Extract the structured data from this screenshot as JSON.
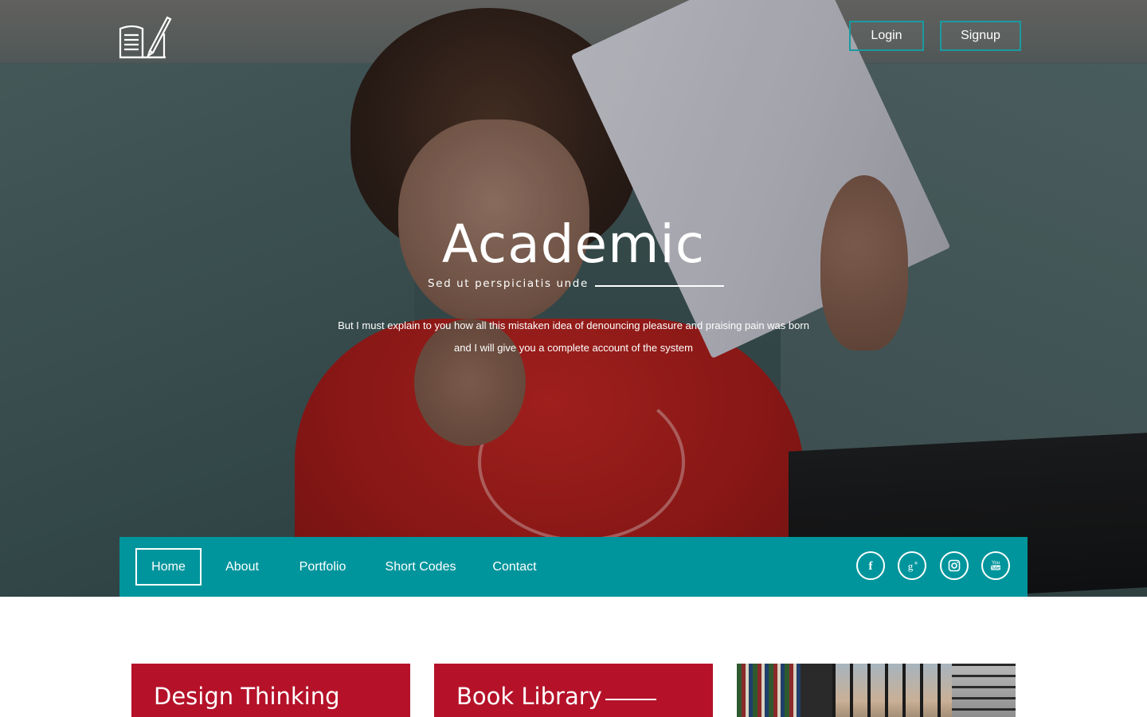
{
  "header": {
    "logo_icon": "book-pencil-icon",
    "login_label": "Login",
    "signup_label": "Signup",
    "accent_color": "#1a9aa0"
  },
  "hero": {
    "title": "Academic",
    "subtitle": "Sed ut perspiciatis unde",
    "description": "But I must explain to you how all this mistaken idea of denouncing pleasure and praising pain was born and I will give you a complete account of the system"
  },
  "nav": {
    "background": "#00959c",
    "items": [
      {
        "label": "Home",
        "active": true
      },
      {
        "label": "About",
        "active": false
      },
      {
        "label": "Portfolio",
        "active": false
      },
      {
        "label": "Short Codes",
        "active": false
      },
      {
        "label": "Contact",
        "active": false
      }
    ],
    "social": [
      "facebook-icon",
      "google-plus-icon",
      "instagram-icon",
      "youtube-icon"
    ]
  },
  "cards": [
    {
      "title": "Design Thinking",
      "color": "#b5122a"
    },
    {
      "title": "Book Library",
      "color": "#b5122a"
    },
    {
      "image": "library-shelves-image"
    }
  ]
}
